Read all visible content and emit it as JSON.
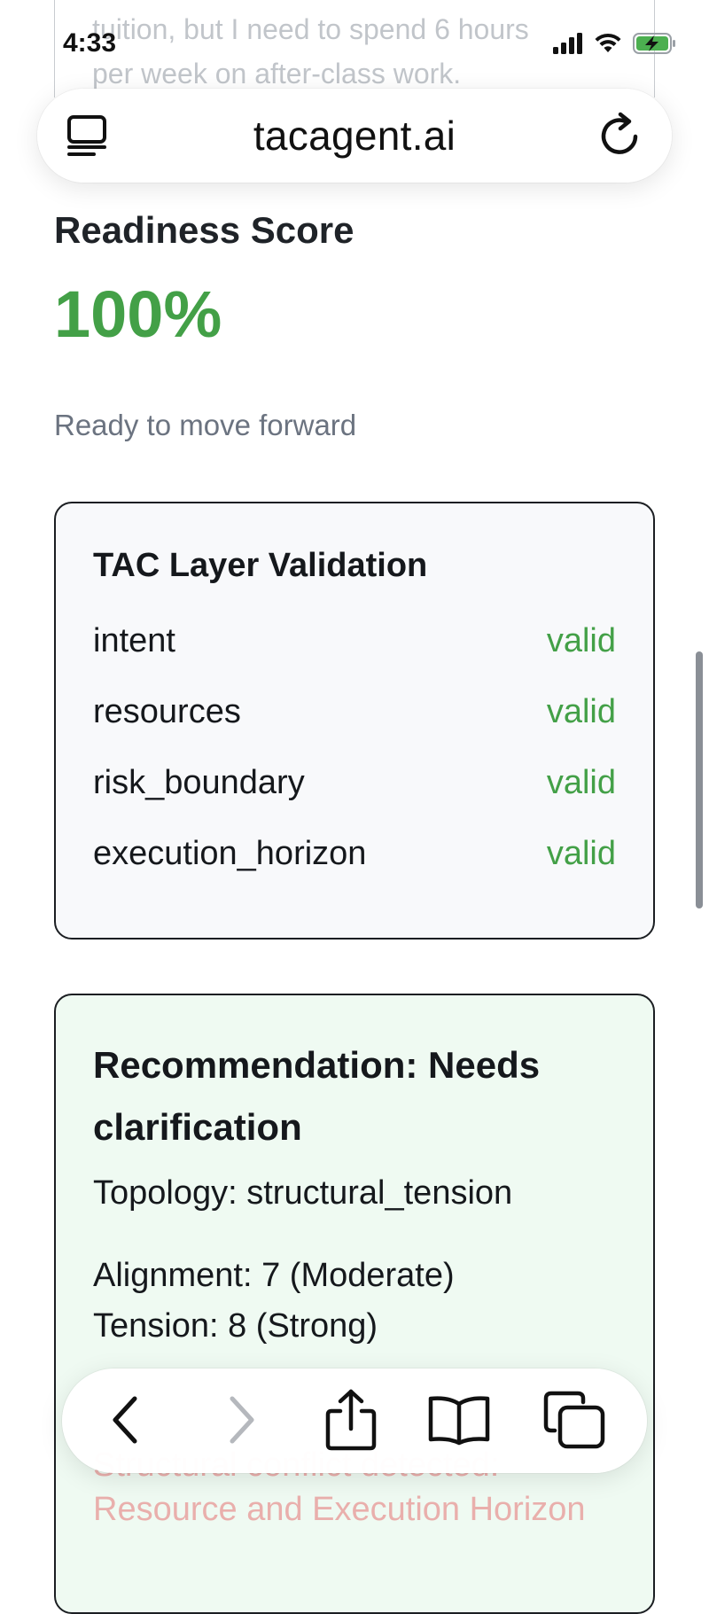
{
  "status_bar": {
    "time": "4:33"
  },
  "browser": {
    "address": "tacagent.ai",
    "reader_icon": "reader-icon",
    "reload_icon": "reload-icon"
  },
  "scrolled_content": {
    "line1": "tuition, but I need to spend 6 hours",
    "line2": "per week on after-class work."
  },
  "readiness": {
    "title": "Readiness Score",
    "value": "100%",
    "status": "Ready to move forward",
    "value_color": "#43a047"
  },
  "validation": {
    "title": "TAC Layer Validation",
    "rows": [
      {
        "name": "intent",
        "status": "valid"
      },
      {
        "name": "resources",
        "status": "valid"
      },
      {
        "name": "risk_boundary",
        "status": "valid"
      },
      {
        "name": "execution_horizon",
        "status": "valid"
      }
    ],
    "status_color": "#43a047"
  },
  "recommendation": {
    "title": "Recommendation: Needs clarification",
    "topology": "Topology: structural_tension",
    "alignment": "Alignment: 7 (Moderate)",
    "tension": "Tension: 8 (Strong)",
    "conflict_line1": "Structural conflict detected:",
    "conflict_line2": "Resource and Execution Horizon"
  },
  "toolbar": {
    "back_icon": "chevron-left-icon",
    "forward_icon": "chevron-right-icon",
    "share_icon": "share-icon",
    "bookmarks_icon": "book-icon",
    "tabs_icon": "tabs-icon"
  }
}
